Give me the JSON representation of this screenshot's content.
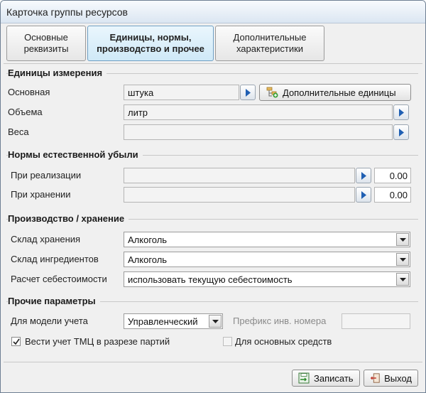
{
  "window": {
    "title": "Карточка группы ресурсов"
  },
  "tabs": [
    {
      "label": "Основные\nреквизиты",
      "active": false
    },
    {
      "label": "Единицы, нормы,\nпроизводство и прочее",
      "active": true
    },
    {
      "label": "Дополнительные\nхарактеристики",
      "active": false
    }
  ],
  "units": {
    "section_title": "Единицы измерения",
    "basic_label": "Основная",
    "basic_value": "штука",
    "extra_units_label": "Дополнительные единицы",
    "volume_label": "Объема",
    "volume_value": "литр",
    "weight_label": "Веса",
    "weight_value": ""
  },
  "losses": {
    "section_title": "Нормы естественной убыли",
    "sale_label": "При реализации",
    "sale_value": "",
    "sale_number": "0.00",
    "storage_label": "При хранении",
    "storage_value": "",
    "storage_number": "0.00"
  },
  "production": {
    "section_title": "Производство / хранение",
    "storage_warehouse_label": "Склад хранения",
    "storage_warehouse_value": "Алкоголь",
    "ingredient_warehouse_label": "Склад ингредиентов",
    "ingredient_warehouse_value": "Алкоголь",
    "cost_calc_label": "Расчет себестоимости",
    "cost_calc_value": "использовать текущую себестоимость"
  },
  "other": {
    "section_title": "Прочие параметры",
    "model_label": "Для модели учета",
    "model_value": "Управленческий",
    "prefix_label": "Префикс инв. номера",
    "prefix_value": "",
    "batch_label": "Вести учет ТМЦ в разрезе партий",
    "batch_checked": true,
    "fixed_assets_label": "Для основных средств",
    "fixed_assets_checked": false
  },
  "footer": {
    "save_label": "Записать",
    "exit_label": "Выход"
  },
  "colors": {
    "arrow_blue": "#1f5fb3",
    "active_tab": "#cfe9f7"
  }
}
